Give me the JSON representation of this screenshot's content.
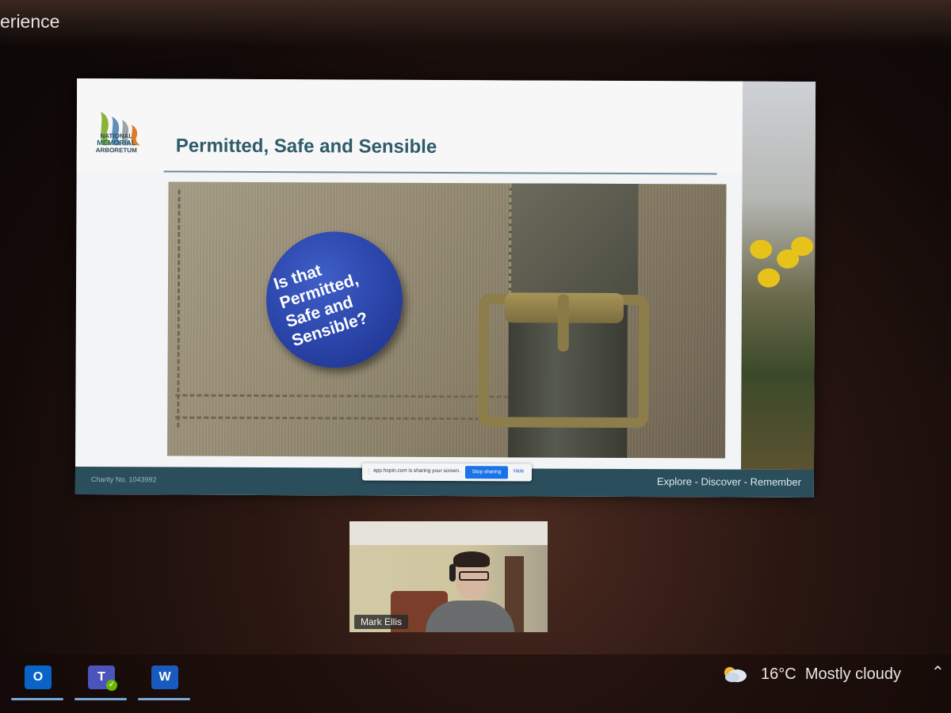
{
  "window": {
    "title": "erience"
  },
  "slide": {
    "logo_lines": [
      "NATIONAL",
      "MEMORIAL",
      "ARBORETUM"
    ],
    "title": "Permitted, Safe and Sensible",
    "badge_lines": [
      "Is that",
      "Permitted,",
      "Safe and",
      "Sensible?"
    ],
    "footer_left": "Charity No. 1043992",
    "footer_right": "Explore - Discover - Remember"
  },
  "share_bar": {
    "message": "app.hopin.com is sharing your screen.",
    "stop_label": "Stop sharing",
    "hide_label": "Hide"
  },
  "video": {
    "participant_name": "Mark Ellis"
  },
  "taskbar": {
    "apps": [
      {
        "name": "Outlook",
        "letter": "O",
        "color": "#0a64c8"
      },
      {
        "name": "Teams",
        "letter": "T",
        "color": "#4b53bc"
      },
      {
        "name": "Word",
        "letter": "W",
        "color": "#185abd"
      }
    ],
    "weather": {
      "temperature": "16°C",
      "condition": "Mostly cloudy",
      "icon": "cloud-icon"
    },
    "overflow_icon": "chevron-up-icon"
  }
}
